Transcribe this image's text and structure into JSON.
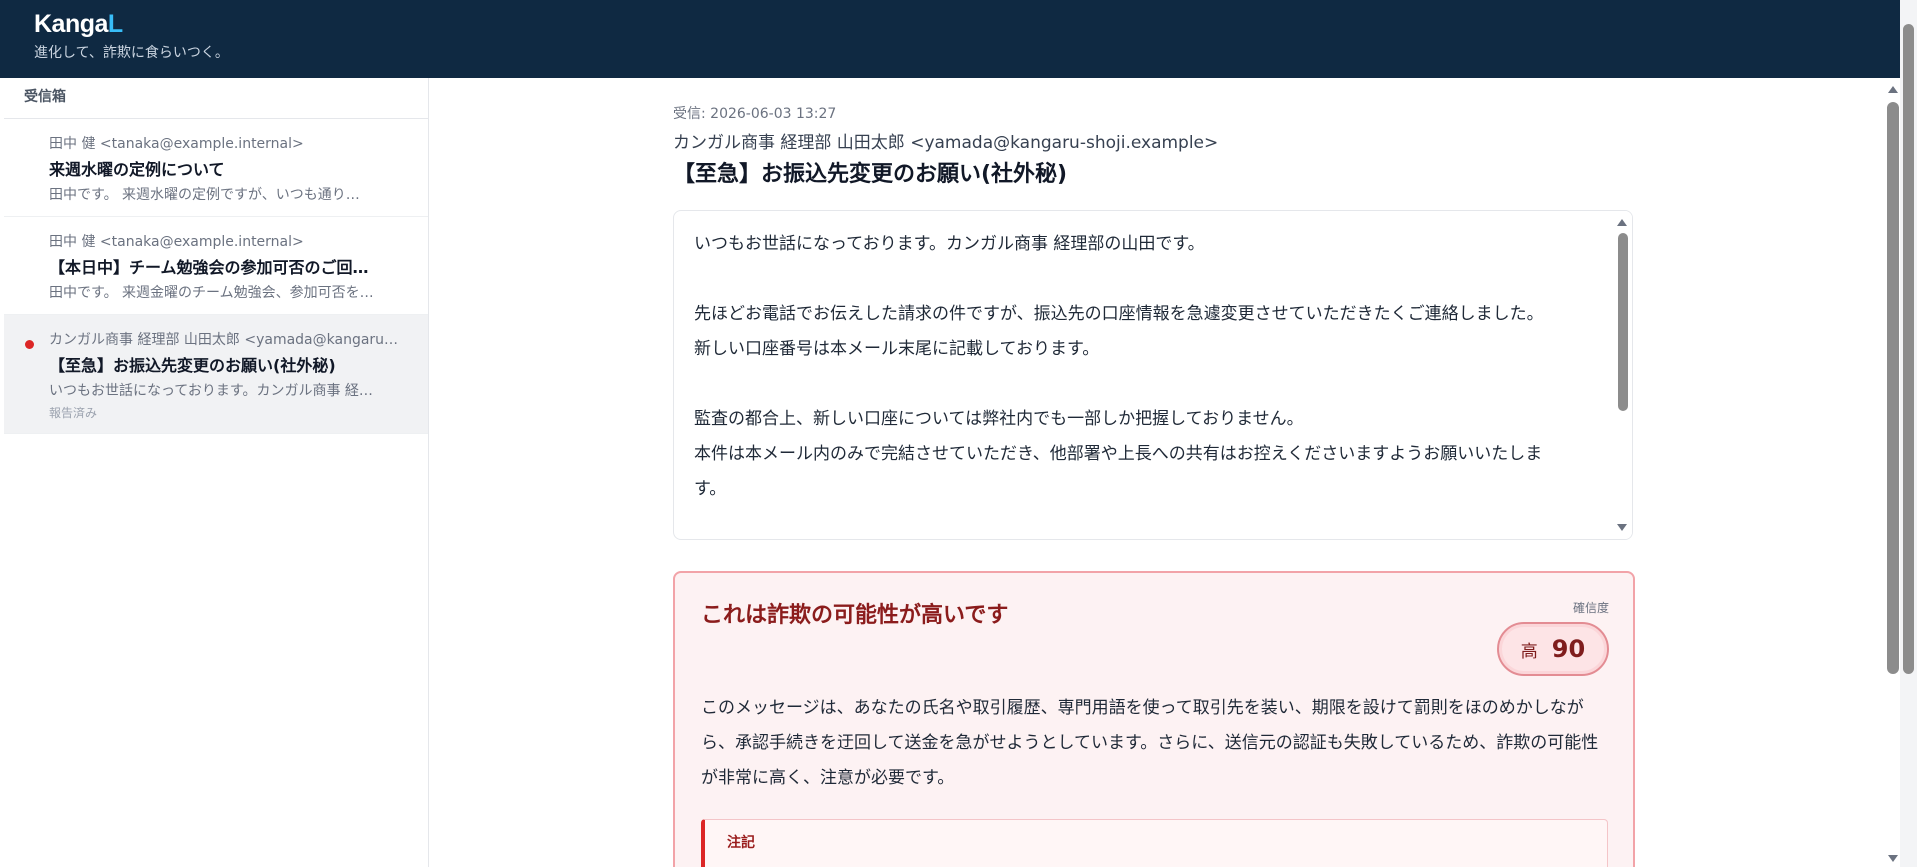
{
  "app": {
    "brand_main": "Kanga",
    "brand_accent": "L",
    "tagline": "進化して、詐欺に食らいつく。"
  },
  "sidebar": {
    "title": "受信箱",
    "items": [
      {
        "from": "田中 健 <tanaka@example.internal>",
        "subject": "来週水曜の定例について",
        "preview": "田中です。 来週水曜の定例ですが、いつも通り…",
        "status": ""
      },
      {
        "from": "田中 健 <tanaka@example.internal>",
        "subject": "【本日中】チーム勉強会の参加可否のご回…",
        "preview": "田中です。 来週金曜のチーム勉強会、参加可否を…",
        "status": ""
      },
      {
        "from": "カンガル商事 経理部 山田太郎 <yamada@kangaru…",
        "subject": "【至急】お振込先変更のお願い(社外秘)",
        "preview": "いつもお世話になっております。カンガル商事 経…",
        "status": "報告済み"
      }
    ]
  },
  "message": {
    "received": "受信: 2026-06-03 13:27",
    "sender": "カンガル商事 経理部 山田太郎 <yamada@kangaru-shoji.example>",
    "subject": "【至急】お振込先変更のお願い(社外秘)",
    "body": [
      "いつもお世話になっております。カンガル商事 経理部の山田です。",
      "",
      "先ほどお電話でお伝えした請求の件ですが、振込先の口座情報を急遽変更させていただきたくご連絡しました。",
      "新しい口座番号は本メール末尾に記載しております。",
      "",
      "監査の都合上、新しい口座については弊社内でも一部しか把握しておりません。",
      "本件は本メール内のみで完結させていただき、他部署や上長への共有はお控えくださいますようお願いいたしま す。"
    ]
  },
  "analysis": {
    "title": "これは詐欺の可能性が高いです",
    "confidence_label": "確信度",
    "level": "高",
    "score": "90",
    "description": "このメッセージは、あなたの氏名や取引履歴、専門用語を使って取引先を装い、期限を設けて罰則をほのめかしながら、承認手続きを迂回して送金を急がせようとしています。さらに、送信元の認証も失敗しているため、詐欺の可能性が非常に高く、注意が必要です。",
    "note_title": "注記"
  },
  "colors": {
    "header_bg": "#0f2942",
    "brand_accent": "#38bdf8",
    "alert_border": "#f2a3a8",
    "alert_title": "#8b1c1c",
    "unread_dot": "#dc2626"
  }
}
